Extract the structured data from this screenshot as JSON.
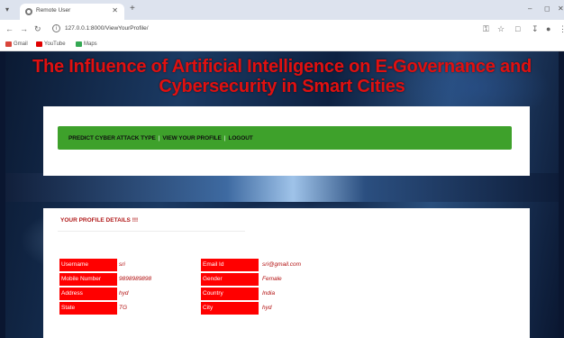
{
  "browser": {
    "tab_title": "Remote User",
    "url": "127.0.0.1:8000/ViewYourProfile/",
    "bookmarks": [
      "Gmail",
      "YouTube",
      "Maps"
    ]
  },
  "page": {
    "title": "The Influence of Artificial Intelligence on E-Governance and Cybersecurity in Smart Cities",
    "nav": {
      "predict": "PREDICT CYBER ATTACK TYPE",
      "view_profile": "VIEW YOUR PROFILE",
      "logout": "LOGOUT",
      "separator": "|"
    },
    "profile": {
      "heading": "YOUR PROFILE DETAILS !!!",
      "left": [
        {
          "label": "Username",
          "value": "sri"
        },
        {
          "label": "Mobile Number",
          "value": "9898989898"
        },
        {
          "label": "Address",
          "value": "hyd"
        },
        {
          "label": "State",
          "value": "TG"
        }
      ],
      "right": [
        {
          "label": "Email Id",
          "value": "sri@gmail.com"
        },
        {
          "label": "Gender",
          "value": "Female"
        },
        {
          "label": "Country",
          "value": "India"
        },
        {
          "label": "City",
          "value": "hyd"
        }
      ]
    }
  },
  "colors": {
    "title_red": "#e01010",
    "nav_green": "#3ea12b",
    "label_red": "#ff0000"
  }
}
